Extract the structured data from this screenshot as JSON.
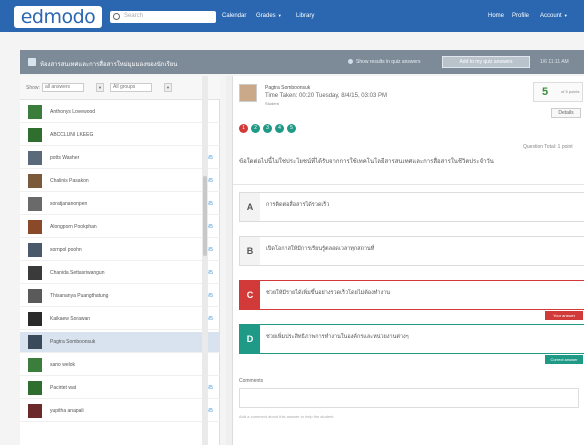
{
  "topnav": {
    "logo": "edmodo",
    "search_placeholder": "Search",
    "links": {
      "calendar": "Calendar",
      "grades": "Grades",
      "library": "Library",
      "home": "Home",
      "profile": "Profile",
      "account": "Account"
    },
    "color": "#2a67b0"
  },
  "group": {
    "title": "ห้องสารสนเทศและการสื่อสารใหม่มุมมองของนักเรียน",
    "filter_link": "Show results in quiz answers",
    "button": "Add to my quiz answers",
    "extra": "1/6 11:11 AM"
  },
  "filters": {
    "label": "Show:",
    "select1": "all answers",
    "select2": "All groups"
  },
  "members": [
    {
      "name": "Anthonys Lovewood",
      "count": "",
      "avatar_color": "#3b7d3b"
    },
    {
      "name": "ABCCLUNI LKEEG",
      "count": "",
      "avatar_color": "#2f6e2f"
    },
    {
      "name": "potts Washer",
      "count": "4/5",
      "avatar_color": "#5a6a7a"
    },
    {
      "name": "Chalinis Pasakon",
      "count": "4/5",
      "avatar_color": "#7a5a3a"
    },
    {
      "name": "soratjananonpen",
      "count": "4/5",
      "avatar_color": "#6a6a6a"
    },
    {
      "name": "Alongporn Pookphan",
      "count": "4/5",
      "avatar_color": "#8a4a2a"
    },
    {
      "name": "sornpol poohn",
      "count": "4/5",
      "avatar_color": "#4a5a6a"
    },
    {
      "name": "Chanida Settasriwangun",
      "count": "4/5",
      "avatar_color": "#3a3a3a"
    },
    {
      "name": "Thisananya Puangthatung",
      "count": "4/5",
      "avatar_color": "#5a5a5a"
    },
    {
      "name": "Kaikaew Sorawan",
      "count": "4/5",
      "avatar_color": "#2a2a2a"
    },
    {
      "name": "Pagtra Somboonsuk",
      "count": "",
      "avatar_color": "#3a4a5a",
      "selected": true
    },
    {
      "name": "sano welok",
      "count": "",
      "avatar_color": "#3b7d3b"
    },
    {
      "name": "Pacirtet wat",
      "count": "4/5",
      "avatar_color": "#2f6e2f"
    },
    {
      "name": "yupitha anapali",
      "count": "4/5",
      "avatar_color": "#6a2a2a"
    }
  ],
  "post": {
    "poster": "Pagtra Somboonsuk",
    "meta": "Time Taken: 00:20 Tuesday, 8/4/15, 03:03 PM",
    "sub": "Student",
    "score": "5",
    "score_label": "of 5 points",
    "details_button": "Details",
    "dots": [
      {
        "label": "1",
        "color": "#d23a3a"
      },
      {
        "label": "2",
        "color": "#1e9a86"
      },
      {
        "label": "3",
        "color": "#1e9a86"
      },
      {
        "label": "4",
        "color": "#1e9a86"
      },
      {
        "label": "5",
        "color": "#1e9a86"
      }
    ],
    "question_total": "Question Total: 1 point",
    "question": "ข้อใดต่อไปนี้ไม่ใช่ประโยชน์ที่ได้รับจากการใช้เทคโนโลยีสารสนเทศและการสื่อสารในชีวิตประจำวัน"
  },
  "options": [
    {
      "letter": "A",
      "text": "การติดต่อสื่อสารได้รวดเร็ว",
      "state": "normal"
    },
    {
      "letter": "B",
      "text": "เปิดโอกาสให้มีการเรียนรู้ตลอดเวลาทุกสถานที่",
      "state": "normal"
    },
    {
      "letter": "C",
      "text": "ช่วยให้มีรายได้เพิ่มขึ้นอย่างรวดเร็วโดยไม่ต้องทำงาน",
      "state": "wrong",
      "badge": "Your answer"
    },
    {
      "letter": "D",
      "text": "ช่วยเพิ่มประสิทธิภาพการทำงานในองค์กรและหน่วยงานต่างๆ",
      "state": "right",
      "badge": "Correct answer"
    }
  ],
  "comments": {
    "label": "Comments",
    "note": "Add a comment about this answer to help the student"
  }
}
